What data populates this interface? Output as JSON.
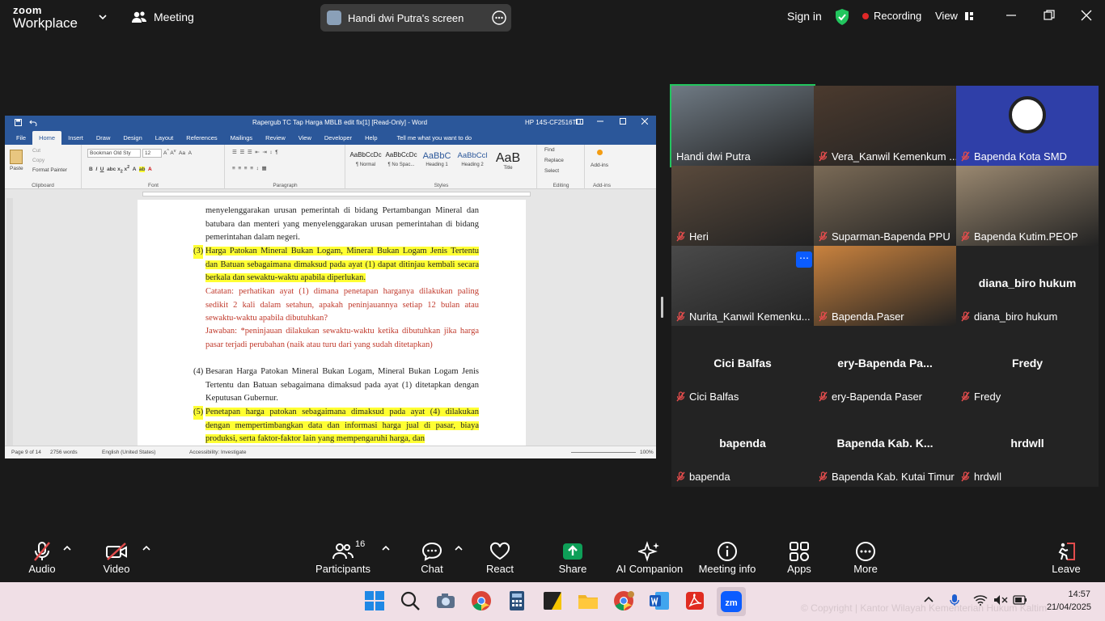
{
  "topbar": {
    "logo_line1": "zoom",
    "logo_line2": "Workplace",
    "meeting_label": "Meeting",
    "screen_share_label": "Handi dwi Putra's screen",
    "sign_in": "Sign in",
    "recording": "Recording",
    "view": "View"
  },
  "word": {
    "title": "Rapergub TC Tap Harga MBLB edit fix[1] [Read-Only]  -  Word",
    "account": "HP 14S-CF2516TU",
    "tabs": [
      "File",
      "Home",
      "Insert",
      "Draw",
      "Design",
      "Layout",
      "References",
      "Mailings",
      "Review",
      "View",
      "Developer",
      "Help"
    ],
    "tell_me": "Tell me what you want to do",
    "ribbon": {
      "paste": "Paste",
      "cut": "Cut",
      "copy": "Copy",
      "format_painter": "Format Painter",
      "clipboard": "Clipboard",
      "font_name": "Bookman Old Sty",
      "font_size": "12",
      "font": "Font",
      "paragraph": "Paragraph",
      "styles_caption": "Styles",
      "styles": [
        {
          "sample": "AaBbCcDc",
          "name": "¶ Normal"
        },
        {
          "sample": "AaBbCcDc",
          "name": "¶ No Spac..."
        },
        {
          "sample": "AaBbC",
          "name": "Heading 1"
        },
        {
          "sample": "AaBbCcl",
          "name": "Heading 2"
        },
        {
          "sample": "AaB",
          "name": "Title"
        }
      ],
      "find": "Find",
      "replace": "Replace",
      "select": "Select",
      "editing": "Editing",
      "addins": "Add-ins",
      "addins_caption": "Add-ins"
    },
    "doc": {
      "p0": "menyelenggarakan urusan pemerintah di bidang Pertambangan Mineral dan batubara dan menteri yang menyelenggarakan urusan pemerintahan di bidang pemerintahan dalam negeri.",
      "p3_num": "(3)",
      "p3": "Harga Patokan Mineral Bukan Logam, Mineral Bukan Logam Jenis Tertentu dan Batuan sebagaimana dimaksud pada ayat (1) dapat ditinjau kembali secara berkala dan sewaktu-waktu apabila diperlukan.",
      "note": "Catatan: perhatikan ayat (1) dimana penetapan harganya dilakukan paling sedikit 2 kali dalam setahun, apakah peninjauannya setiap 12 bulan atau sewaktu-waktu apabila dibutuhkan?",
      "answer": "Jawaban: *peninjauan dilakukan sewaktu-waktu ketika dibutuhkan jika harga pasar terjadi perubahan (naik atau turu dari yang sudah ditetapkan)",
      "p4_num": "(4)",
      "p4": "Besaran Harga Patokan Mineral Bukan Logam, Mineral Bukan Logam Jenis Tertentu dan Batuan sebagaimana dimaksud pada ayat (1) ditetapkan dengan Keputusan Gubernur.",
      "p5_num": "(5)",
      "p5": "Penetapan harga patokan sebagaimana dimaksud pada ayat (4) dilakukan dengan mempertimbangkan data dan informasi harga jual di pasar, biaya produksi, serta faktor-faktor lain yang mempengaruhi harga, dan"
    },
    "status": {
      "page": "Page 9 of 14",
      "words": "2756 words",
      "language": "English (United States)",
      "accessibility": "Accessibility: Investigate",
      "zoom": "100%"
    }
  },
  "participants_grid": [
    {
      "name": "Handi dwi Putra",
      "muted": false,
      "kind": "video",
      "active": true
    },
    {
      "name": "Vera_Kanwil Kemenkum ...",
      "muted": true,
      "kind": "video"
    },
    {
      "name": "Bapenda Kota SMD",
      "muted": true,
      "kind": "logo"
    },
    {
      "name": "Heri",
      "muted": true,
      "kind": "video"
    },
    {
      "name": "Suparman-Bapenda PPU",
      "muted": true,
      "kind": "video"
    },
    {
      "name": "Bapenda Kutim.PEOP",
      "muted": true,
      "kind": "video"
    },
    {
      "name": "Nurita_Kanwil Kemenku...",
      "muted": true,
      "kind": "video"
    },
    {
      "name": "Bapenda.Paser",
      "muted": true,
      "kind": "video"
    },
    {
      "name": "diana_biro hukum",
      "muted": true,
      "kind": "text",
      "big": "diana_biro hukum"
    },
    {
      "name": "Cici Balfas",
      "muted": true,
      "kind": "text",
      "big": "Cici Balfas"
    },
    {
      "name": "ery-Bapenda Paser",
      "muted": true,
      "kind": "text",
      "big": "ery-Bapenda  Pa..."
    },
    {
      "name": "Fredy",
      "muted": true,
      "kind": "text",
      "big": "Fredy"
    },
    {
      "name": "bapenda",
      "muted": true,
      "kind": "text",
      "big": "bapenda"
    },
    {
      "name": "Bapenda Kab. Kutai Timur",
      "muted": true,
      "kind": "text",
      "big": "Bapenda Kab. K..."
    },
    {
      "name": "hrdwll",
      "muted": true,
      "kind": "text",
      "big": "hrdwll"
    }
  ],
  "toolbar": {
    "audio": "Audio",
    "video": "Video",
    "participants": "Participants",
    "participants_count": "16",
    "chat": "Chat",
    "react": "React",
    "share": "Share",
    "ai": "AI Companion",
    "info": "Meeting info",
    "apps": "Apps",
    "more": "More",
    "leave": "Leave"
  },
  "taskbar": {
    "copyright": "© Copyright | Kantor Wilayah Kementerian Hukum Kaltim",
    "time": "14:57",
    "date": "21/04/2025"
  },
  "colors": {
    "zoom_green": "#22c55e",
    "recording_red": "#e02828",
    "word_blue": "#2b579a",
    "highlight": "#ffff33",
    "share_green": "#0e9f58",
    "muted_red": "#e24c4c"
  }
}
